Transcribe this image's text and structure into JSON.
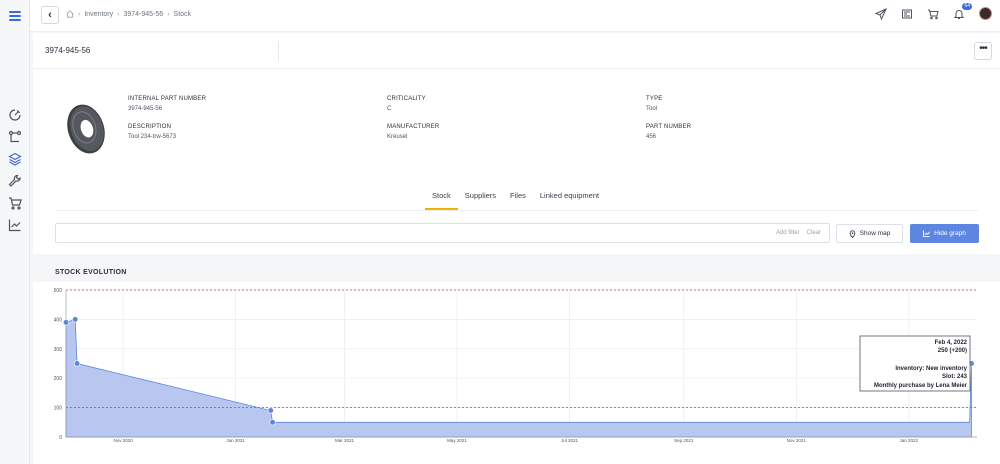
{
  "breadcrumb": [
    "Inventory",
    "3974-945-56",
    "Stock"
  ],
  "notifications_count": "64",
  "header": {
    "title": "3974-945-56"
  },
  "details": {
    "internal_part_number_label": "INTERNAL PART NUMBER",
    "internal_part_number": "3974-945-56",
    "description_label": "DESCRIPTION",
    "description": "Tool 234-trw-5673",
    "criticality_label": "CRITICALITY",
    "criticality": "C",
    "manufacturer_label": "MANUFACTURER",
    "manufacturer": "Kreusel",
    "type_label": "TYPE",
    "type": "Tool",
    "part_number_label": "PART NUMBER",
    "part_number": "456"
  },
  "tabs": [
    "Stock",
    "Suppliers",
    "Files",
    "Linked equipment"
  ],
  "filter": {
    "add_filter": "Add filter",
    "clear": "Clear"
  },
  "buttons": {
    "show_map": "Show map",
    "hide_graph": "Hide graph"
  },
  "chart_title": "STOCK EVOLUTION",
  "colors": {
    "accent": "#5c86e0",
    "tab_underline": "#f0b400",
    "area_fill": "#b3c4ef",
    "threshold_line": "#e03b3b"
  },
  "chart_data": {
    "type": "area",
    "title": "STOCK EVOLUTION",
    "x_ticks": [
      "Nov 2020",
      "Jan 2021",
      "Mar 2021",
      "May 2021",
      "Jul 2021",
      "Sep 2021",
      "Nov 2021",
      "Jan 2022"
    ],
    "y_ticks": [
      0,
      100,
      200,
      300,
      400,
      500
    ],
    "ylim": [
      0,
      500
    ],
    "xlim": [
      "2020-10-01",
      "2022-02-07"
    ],
    "grid": true,
    "series": [
      {
        "points": [
          {
            "x": "2020-10-01",
            "y": 390
          },
          {
            "x": "2020-10-06",
            "y": 400
          },
          {
            "x": "2020-10-07",
            "y": 250
          },
          {
            "x": "2021-01-20",
            "y": 90
          },
          {
            "x": "2021-01-21",
            "y": 50
          },
          {
            "x": "2022-02-03",
            "y": 50
          },
          {
            "x": "2022-02-04",
            "y": 250
          }
        ],
        "markers": [
          {
            "x": "2020-10-01",
            "y": 390
          },
          {
            "x": "2020-10-06",
            "y": 400
          },
          {
            "x": "2020-10-07",
            "y": 250
          },
          {
            "x": "2021-01-20",
            "y": 90
          },
          {
            "x": "2021-01-21",
            "y": 50
          },
          {
            "x": "2022-02-04",
            "y": 250
          }
        ]
      }
    ],
    "thresholds": [
      100,
      500
    ],
    "tooltip": {
      "date": "Feb 4, 2022",
      "value": "250 (+200)",
      "line1": "Inventory: New inventory",
      "line2": "Slot: 243",
      "line3": "Monthly purchase by Lena Meier"
    }
  }
}
